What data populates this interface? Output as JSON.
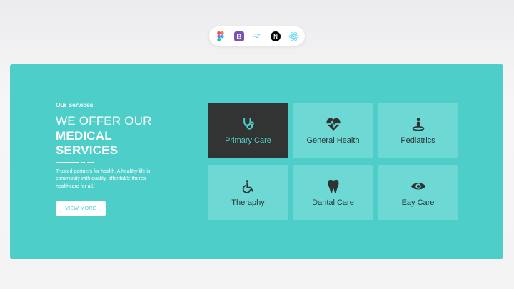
{
  "toolbar": {
    "items": [
      {
        "icon": "figma-icon"
      },
      {
        "icon": "bootstrap-icon",
        "glyph": "B"
      },
      {
        "icon": "tailwind-icon"
      },
      {
        "icon": "nextjs-icon",
        "glyph": "N"
      },
      {
        "icon": "react-icon"
      }
    ]
  },
  "services": {
    "kicker": "Our Services",
    "heading_line1": "WE OFFER OUR",
    "heading_line2": "MEDICAL SERVICES",
    "description": "Trusted partners for health. A healthy life is community with quality, affordable theres healthcare for all.",
    "button_label": "VIEW MORE",
    "cards": [
      {
        "label": "Primary Care",
        "icon": "stethoscope-icon",
        "active": true
      },
      {
        "label": "General Health",
        "icon": "heart-pulse-icon",
        "active": false
      },
      {
        "label": "Pediatrics",
        "icon": "child-icon",
        "active": false
      },
      {
        "label": "Theraphy",
        "icon": "wheelchair-icon",
        "active": false
      },
      {
        "label": "Dantal Care",
        "icon": "tooth-icon",
        "active": false
      },
      {
        "label": "Eay Care",
        "icon": "eye-icon",
        "active": false
      }
    ]
  },
  "colors": {
    "panel": "#4ecec8",
    "card": "#6ed9d4",
    "card_active": "#323333",
    "text_dark": "#2d3434"
  }
}
